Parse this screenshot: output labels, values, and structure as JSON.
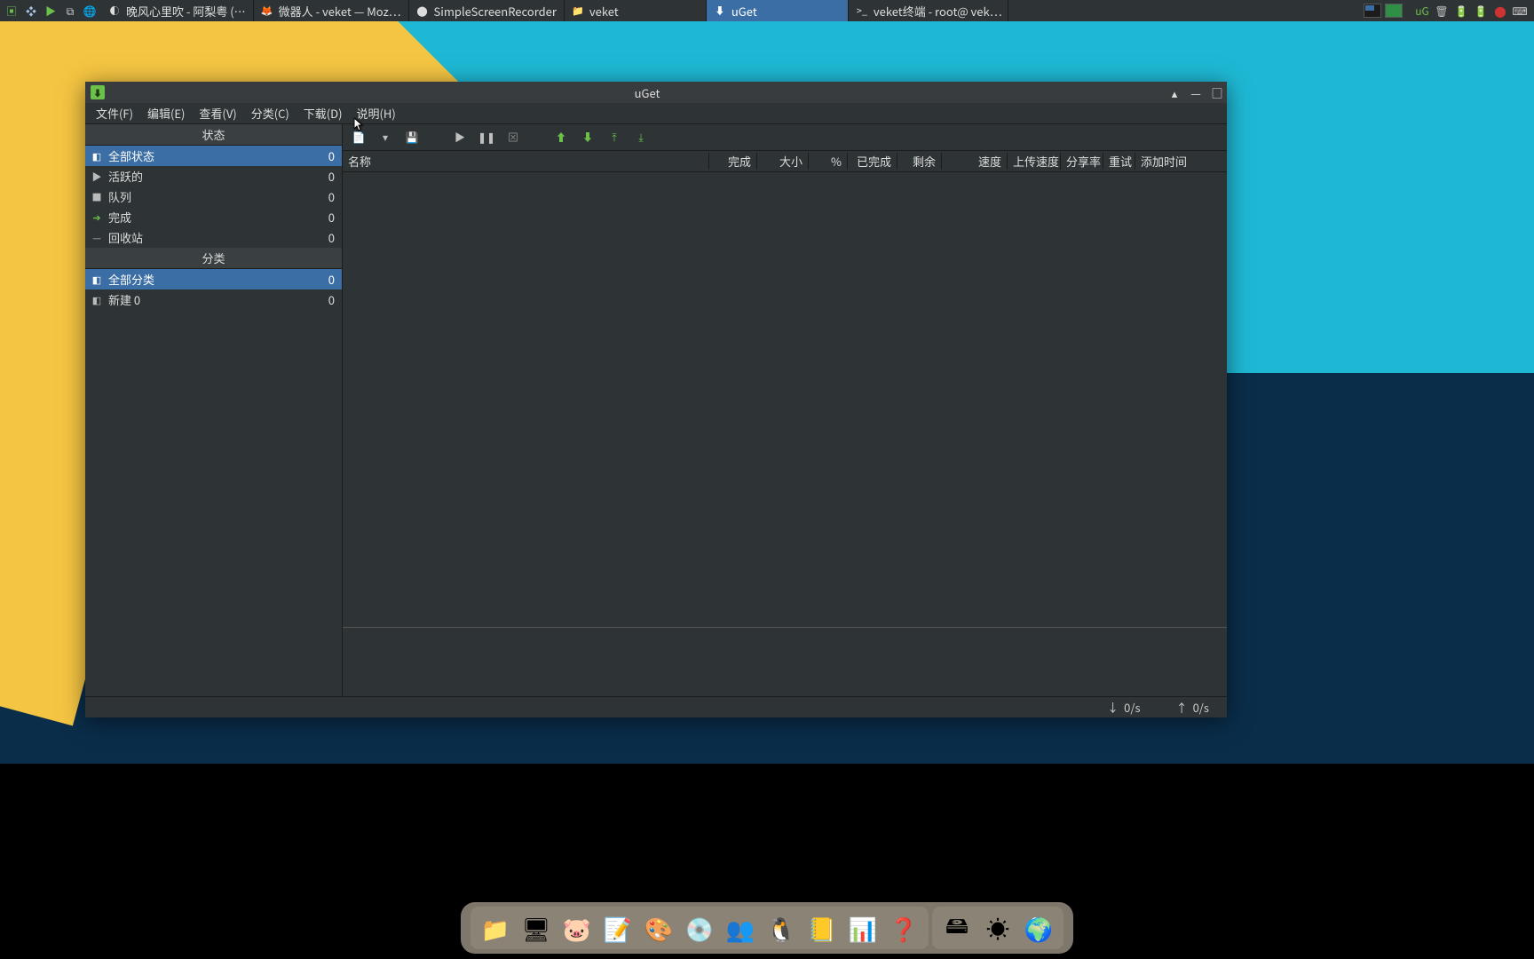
{
  "top_panel": {
    "windows": [
      {
        "icon": "◐",
        "label": "晚风心里吹 - 阿梨粤 (…",
        "active": false
      },
      {
        "icon": "🦊",
        "label": "微器人 - veket — Moz…",
        "active": false
      },
      {
        "icon": "⬤",
        "label": "SimpleScreenRecorder",
        "active": false
      },
      {
        "icon": "📁",
        "label": "veket",
        "active": false
      },
      {
        "icon": "⬇",
        "label": "uGet",
        "active": true
      },
      {
        "icon": ">_",
        "label": "veket终端 - root@ vek…",
        "active": false
      }
    ],
    "tray": {
      "items": [
        "uG",
        "🗑",
        "🔋",
        "🔋",
        "⬤",
        "⌨"
      ]
    }
  },
  "uget": {
    "title": "uGet",
    "menu": [
      "文件(F)",
      "编辑(E)",
      "查看(V)",
      "分类(C)",
      "下载(D)",
      "说明(H)"
    ],
    "sidebar": {
      "status_header": "状态",
      "status_items": [
        {
          "icon": "◧",
          "label": "全部状态",
          "count": "0",
          "selected": true
        },
        {
          "icon": "▶",
          "label": "活跃的",
          "count": "0",
          "selected": false
        },
        {
          "icon": "■",
          "label": "队列",
          "count": "0",
          "selected": false
        },
        {
          "icon": "➔",
          "label": "完成",
          "count": "0",
          "selected": false,
          "icon_color": "#6cc04a"
        },
        {
          "icon": "—",
          "label": "回收站",
          "count": "0",
          "selected": false
        }
      ],
      "category_header": "分类",
      "category_items": [
        {
          "icon": "◧",
          "label": "全部分类",
          "count": "0",
          "selected": true
        },
        {
          "icon": "◧",
          "label": "新建 0",
          "count": "0",
          "selected": false
        }
      ]
    },
    "toolbar": {
      "new": "new",
      "dropdown": "dropdown",
      "save": "save",
      "play": "play",
      "pause": "pause",
      "stop": "stop",
      "up": "up",
      "down": "down",
      "top": "top",
      "bottom": "bottom"
    },
    "columns": [
      "名称",
      "完成",
      "大小",
      "%",
      "已完成",
      "剩余",
      "速度",
      "上传速度",
      "分享率",
      "重试",
      "添加时间"
    ],
    "statusbar": {
      "down": "0/s",
      "up": "0/s"
    }
  },
  "dock": {
    "group1": [
      "files",
      "screenshot",
      "pig",
      "editor",
      "paint",
      "media",
      "chat",
      "tux",
      "notes",
      "sheet",
      "help"
    ],
    "group2": [
      "disk",
      "sun",
      "globe"
    ]
  }
}
